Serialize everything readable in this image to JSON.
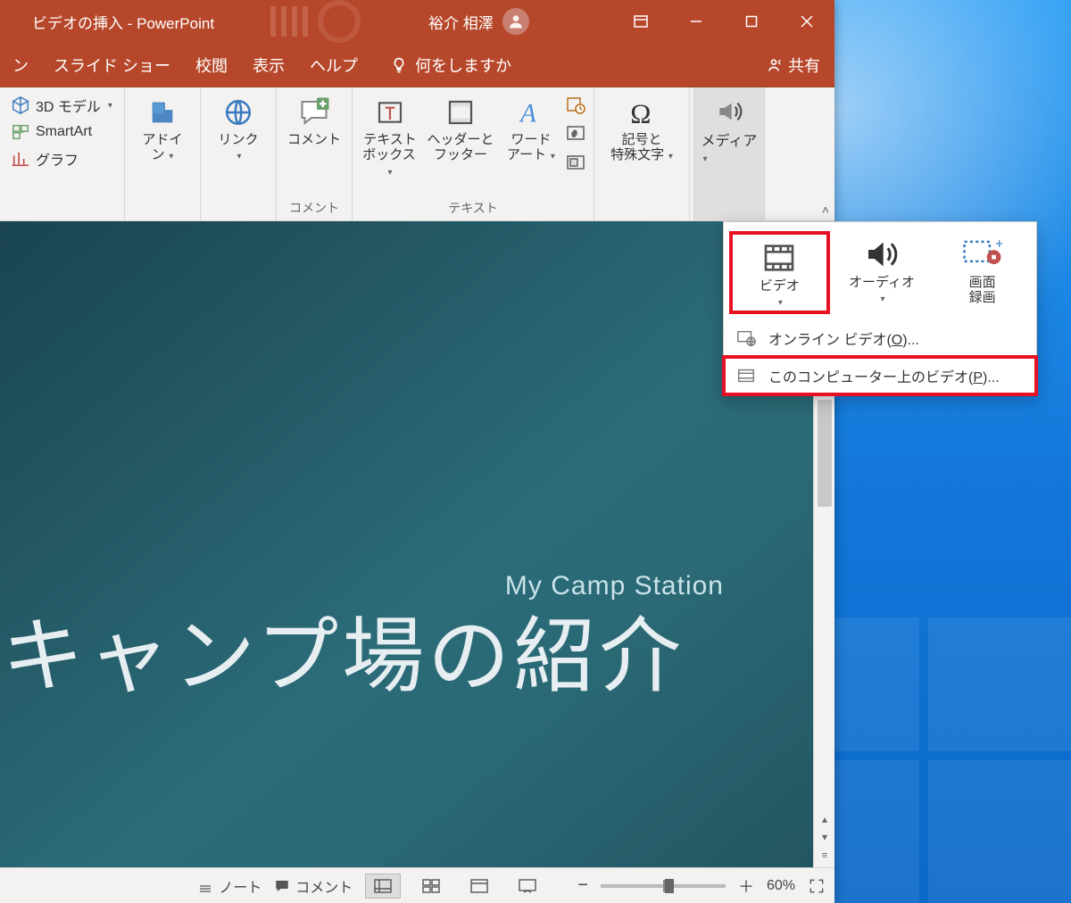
{
  "title": "ビデオの挿入  -  PowerPoint",
  "user_name": "裕介 相澤",
  "tabs": [
    "ン",
    "スライド ショー",
    "校閲",
    "表示",
    "ヘルプ"
  ],
  "tell_me": "何をしますか",
  "share": "共有",
  "ribbon": {
    "illustrations": {
      "model3d": "3D モデル",
      "smartart": "SmartArt",
      "chart": "グラフ"
    },
    "addins": {
      "label": "アドイン",
      "btn": "アドイ\nン"
    },
    "links": {
      "btn": "リンク"
    },
    "comments": {
      "group": "コメント",
      "btn": "コメント"
    },
    "text": {
      "group": "テキスト",
      "textbox": "テキスト\nボックス",
      "headerfooter": "ヘッダーと\nフッター",
      "wordart": "ワード\nアート"
    },
    "symbols": {
      "btn": "記号と\n特殊文字"
    },
    "media": {
      "btn": "メディア"
    }
  },
  "slide": {
    "subtitle": "My Camp Station",
    "title": "キャンプ場の紹介"
  },
  "flyout": {
    "video": "ビデオ",
    "audio": "オーディオ",
    "screenrec": "画面\n録画",
    "online_pre": "オンライン ビデオ(",
    "online_key": "O",
    "online_post": ")...",
    "pc_pre": "このコンピューター上のビデオ(",
    "pc_key": "P",
    "pc_post": ")..."
  },
  "status": {
    "notes": "ノート",
    "comments": "コメント",
    "zoom": "60%"
  }
}
